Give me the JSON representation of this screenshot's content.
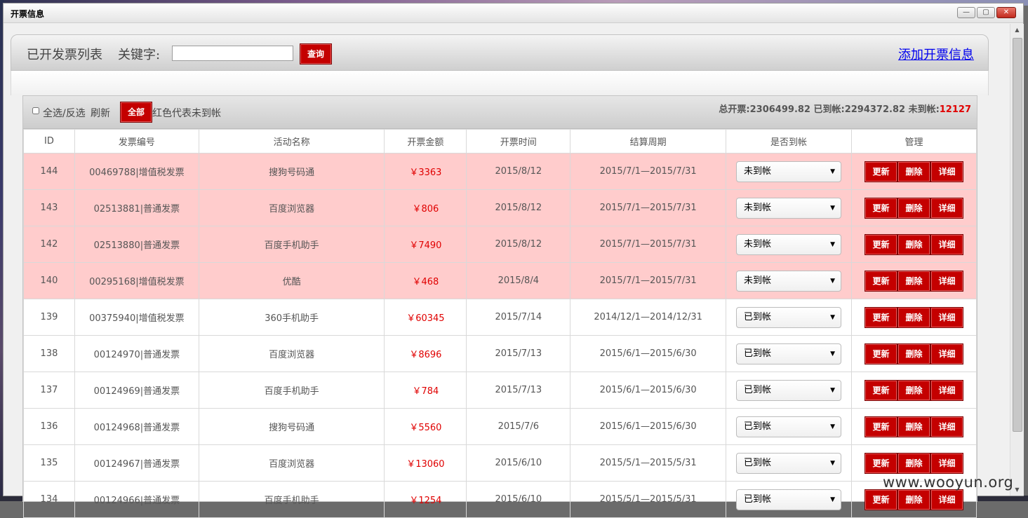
{
  "window": {
    "title": "开票信息",
    "minimize": "—",
    "maximize": "▢",
    "close": "✕"
  },
  "toolbar": {
    "list_title": "已开发票列表",
    "keyword_label": "关键字:",
    "keyword_value": "",
    "search_label": "查询",
    "add_label": "添加开票信息"
  },
  "list": {
    "select_all_label": "全选/反选",
    "refresh_label": "刷新",
    "all_label": "全部",
    "legend": "红色代表未到帐",
    "total_label": "总开票:2306499.82 已到帐:2294372.82 未到帐:",
    "unpaid_total": "12127"
  },
  "columns": [
    "ID",
    "发票编号",
    "活动名称",
    "开票金额",
    "开票时间",
    "结算周期",
    "是否到帐",
    "管理"
  ],
  "action_labels": {
    "update": "更新",
    "delete": "删除",
    "detail": "详细"
  },
  "rows": [
    {
      "id": "144",
      "invoice": "00469788|增值税发票",
      "activity": "搜狗号码通",
      "amount": "￥3363",
      "date": "2015/8/12",
      "period": "2015/7/1—2015/7/31",
      "status": "未到帐",
      "unpaid": true
    },
    {
      "id": "143",
      "invoice": "02513881|普通发票",
      "activity": "百度浏览器",
      "amount": "￥806",
      "date": "2015/8/12",
      "period": "2015/7/1—2015/7/31",
      "status": "未到帐",
      "unpaid": true
    },
    {
      "id": "142",
      "invoice": "02513880|普通发票",
      "activity": "百度手机助手",
      "amount": "￥7490",
      "date": "2015/8/12",
      "period": "2015/7/1—2015/7/31",
      "status": "未到帐",
      "unpaid": true
    },
    {
      "id": "140",
      "invoice": "00295168|增值税发票",
      "activity": "优酷",
      "amount": "￥468",
      "date": "2015/8/4",
      "period": "2015/7/1—2015/7/31",
      "status": "未到帐",
      "unpaid": true
    },
    {
      "id": "139",
      "invoice": "00375940|增值税发票",
      "activity": "360手机助手",
      "amount": "￥60345",
      "date": "2015/7/14",
      "period": "2014/12/1—2014/12/31",
      "status": "已到帐",
      "unpaid": false
    },
    {
      "id": "138",
      "invoice": "00124970|普通发票",
      "activity": "百度浏览器",
      "amount": "￥8696",
      "date": "2015/7/13",
      "period": "2015/6/1—2015/6/30",
      "status": "已到帐",
      "unpaid": false
    },
    {
      "id": "137",
      "invoice": "00124969|普通发票",
      "activity": "百度手机助手",
      "amount": "￥784",
      "date": "2015/7/13",
      "period": "2015/6/1—2015/6/30",
      "status": "已到帐",
      "unpaid": false
    },
    {
      "id": "136",
      "invoice": "00124968|普通发票",
      "activity": "搜狗号码通",
      "amount": "￥5560",
      "date": "2015/7/6",
      "period": "2015/6/1—2015/6/30",
      "status": "已到帐",
      "unpaid": false
    },
    {
      "id": "135",
      "invoice": "00124967|普通发票",
      "activity": "百度浏览器",
      "amount": "￥13060",
      "date": "2015/6/10",
      "period": "2015/5/1—2015/5/31",
      "status": "已到帐",
      "unpaid": false
    },
    {
      "id": "134",
      "invoice": "00124966|普通发票",
      "activity": "百度手机助手",
      "amount": "￥1254",
      "date": "2015/6/10",
      "period": "2015/5/1—2015/5/31",
      "status": "已到帐",
      "unpaid": false
    }
  ],
  "watermark": "www.wooyun.org",
  "colors": {
    "accent_red": "#c40000",
    "unpaid_row": "#ffcccc",
    "amount_red": "#e00000",
    "link_blue": "#0000ee"
  },
  "icons": {
    "scroll_up": "▲",
    "scroll_down": "▼",
    "dropdown": "▼"
  }
}
